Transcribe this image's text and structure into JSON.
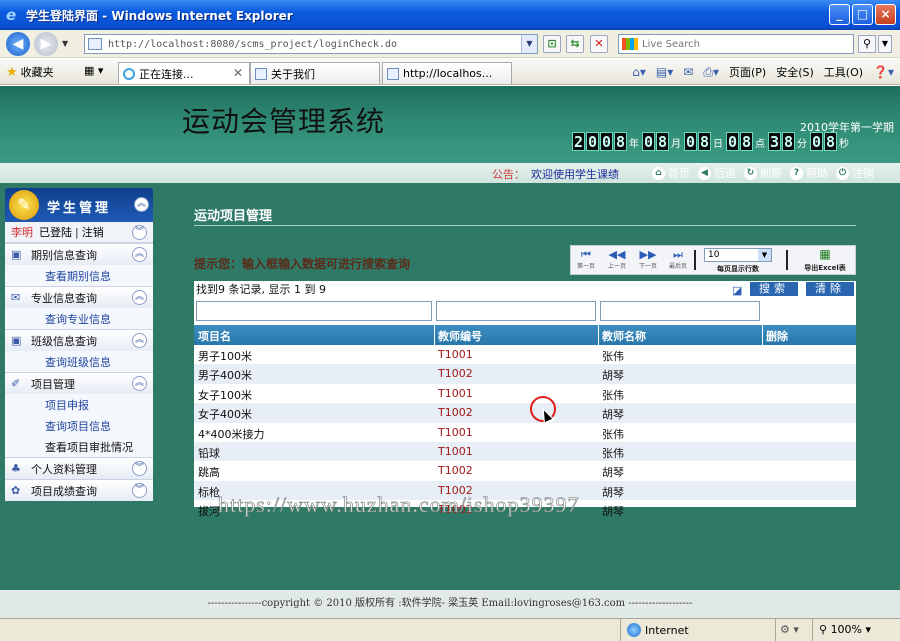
{
  "window": {
    "title": "学生登陆界面 - Windows Internet Explorer",
    "minimize": "_",
    "maximize": "□",
    "close": "×"
  },
  "address": {
    "url": "http://localhost:8080/scms_project/loginCheck.do",
    "search_placeholder": "Live Search"
  },
  "favorites_label": "收藏夹",
  "tabs": [
    {
      "label": "正在连接...",
      "icon": "loading-icon"
    },
    {
      "label": "关于我们",
      "icon": "page-icon"
    },
    {
      "label": "http://localhos...",
      "icon": "page-icon"
    }
  ],
  "commands": {
    "page": "页面(P)",
    "safety": "安全(S)",
    "tools": "工具(O)"
  },
  "banner": {
    "system_title": "运动会管理系统",
    "term": "2010学年第一学期",
    "clock_digits": {
      "year": "2008",
      "month": "08",
      "day": "08",
      "hour": "08",
      "minute": "38",
      "second": "08"
    },
    "clock_units": {
      "year": "年",
      "month": "月",
      "day": "日",
      "hour": "点",
      "minute": "分",
      "second": "秒"
    }
  },
  "notice": {
    "label": "公告：",
    "text": "欢迎使用学生课绩",
    "links": [
      "首页",
      "后退",
      "刷新",
      "帮助",
      "注销"
    ]
  },
  "sidebar": {
    "title": "学生管理",
    "user": {
      "name": "李明",
      "status": "已登陆",
      "logout": "注销"
    },
    "groups": [
      {
        "label": "期别信息查询",
        "icon": "calendar-icon",
        "items": [
          "查看期别信息"
        ]
      },
      {
        "label": "专业信息查询",
        "icon": "mail-icon",
        "items": [
          "查询专业信息"
        ]
      },
      {
        "label": "班级信息查询",
        "icon": "class-icon",
        "items": [
          "查询班级信息"
        ]
      },
      {
        "label": "项目管理",
        "icon": "project-icon",
        "items": [
          "项目申报",
          "查询项目信息",
          "查看项目审批情况"
        ]
      },
      {
        "label": "个人资料管理",
        "icon": "person-icon",
        "items": []
      },
      {
        "label": "项目成绩查询",
        "icon": "score-icon",
        "items": []
      }
    ]
  },
  "main": {
    "title": "运动项目管理",
    "hint": "提示您：输入框输入数据可进行搜索查询",
    "pager": {
      "first": "第一页",
      "prev": "上一页",
      "next": "下一页",
      "last": "最后页",
      "page_size": "10",
      "page_size_label": "每页显示行数",
      "export_label": "导出Excel表"
    },
    "record_info": "找到9 条记录, 显示 1 到 9",
    "search_button": "搜索",
    "clear_button": "清除",
    "columns": [
      "项目名",
      "教师编号",
      "教师名称",
      "删除"
    ],
    "rows": [
      {
        "name": "男子100米",
        "teacher_id": "T1001",
        "teacher_name": "张伟"
      },
      {
        "name": "男子400米",
        "teacher_id": "T1002",
        "teacher_name": "胡琴"
      },
      {
        "name": "女子100米",
        "teacher_id": "T1001",
        "teacher_name": "张伟"
      },
      {
        "name": "女子400米",
        "teacher_id": "T1002",
        "teacher_name": "胡琴"
      },
      {
        "name": "4*400米接力",
        "teacher_id": "T1001",
        "teacher_name": "张伟"
      },
      {
        "name": "铅球",
        "teacher_id": "T1001",
        "teacher_name": "张伟"
      },
      {
        "name": "跳高",
        "teacher_id": "T1002",
        "teacher_name": "胡琴"
      },
      {
        "name": "标枪",
        "teacher_id": "T1002",
        "teacher_name": "胡琴"
      },
      {
        "name": "拔河",
        "teacher_id": "T1002",
        "teacher_name": "胡琴"
      }
    ]
  },
  "watermark": "https://www.huzhan.com/ishop39397",
  "footer": "----------------copyright © 2010 版权所有 :软件学院- 梁玉英  Email:lovingroses@163.com  -------------------",
  "status": {
    "zone": "Internet",
    "zoom": "100%"
  }
}
